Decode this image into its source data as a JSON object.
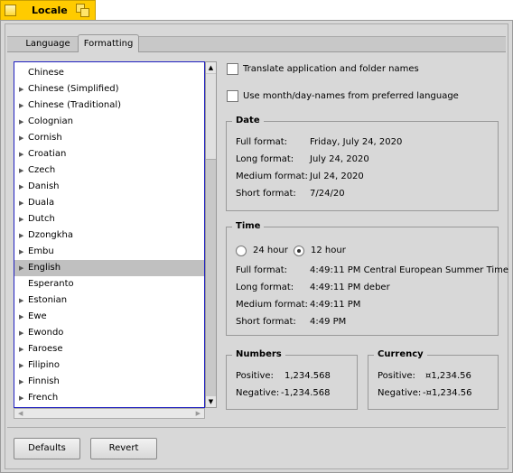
{
  "window": {
    "title": "Locale"
  },
  "tabs": [
    {
      "label": "Language",
      "selected": false
    },
    {
      "label": "Formatting",
      "selected": true
    }
  ],
  "languages": [
    {
      "label": "Chinese",
      "expandable": false
    },
    {
      "label": "Chinese (Simplified)",
      "expandable": true
    },
    {
      "label": "Chinese (Traditional)",
      "expandable": true
    },
    {
      "label": "Colognian",
      "expandable": true
    },
    {
      "label": "Cornish",
      "expandable": true
    },
    {
      "label": "Croatian",
      "expandable": true
    },
    {
      "label": "Czech",
      "expandable": true
    },
    {
      "label": "Danish",
      "expandable": true
    },
    {
      "label": "Duala",
      "expandable": true
    },
    {
      "label": "Dutch",
      "expandable": true
    },
    {
      "label": "Dzongkha",
      "expandable": true
    },
    {
      "label": "Embu",
      "expandable": true
    },
    {
      "label": "English",
      "expandable": true,
      "selected": true
    },
    {
      "label": "Esperanto",
      "expandable": false
    },
    {
      "label": "Estonian",
      "expandable": true
    },
    {
      "label": "Ewe",
      "expandable": true
    },
    {
      "label": "Ewondo",
      "expandable": true
    },
    {
      "label": "Faroese",
      "expandable": true
    },
    {
      "label": "Filipino",
      "expandable": true
    },
    {
      "label": "Finnish",
      "expandable": true
    },
    {
      "label": "French",
      "expandable": true
    }
  ],
  "options": {
    "translate_names": {
      "label": "Translate application and folder names",
      "checked": false
    },
    "month_day_names": {
      "label": "Use month/day-names from preferred language",
      "checked": false
    }
  },
  "date": {
    "title": "Date",
    "rows": [
      {
        "k": "Full format:",
        "v": "Friday, July 24, 2020"
      },
      {
        "k": "Long format:",
        "v": "July 24, 2020"
      },
      {
        "k": "Medium format:",
        "v": "Jul 24, 2020"
      },
      {
        "k": "Short format:",
        "v": "7/24/20"
      }
    ]
  },
  "time": {
    "title": "Time",
    "h24": "24 hour",
    "h12": "12 hour",
    "selected": "12 hour",
    "rows": [
      {
        "k": "Full format:",
        "v": "4:49:11 PM Central European Summer Time"
      },
      {
        "k": "Long format:",
        "v": "4:49:11 PM deber"
      },
      {
        "k": "Medium format:",
        "v": "4:49:11 PM"
      },
      {
        "k": "Short format:",
        "v": "4:49 PM"
      }
    ]
  },
  "numbers": {
    "title": "Numbers",
    "positive_label": "Positive:",
    "positive": "1,234.568",
    "negative_label": "Negative:",
    "negative": "-1,234.568"
  },
  "currency": {
    "title": "Currency",
    "positive_label": "Positive:",
    "positive": "¤1,234.56",
    "negative_label": "Negative:",
    "negative": "-¤1,234.56"
  },
  "buttons": {
    "defaults": "Defaults",
    "revert": "Revert"
  }
}
